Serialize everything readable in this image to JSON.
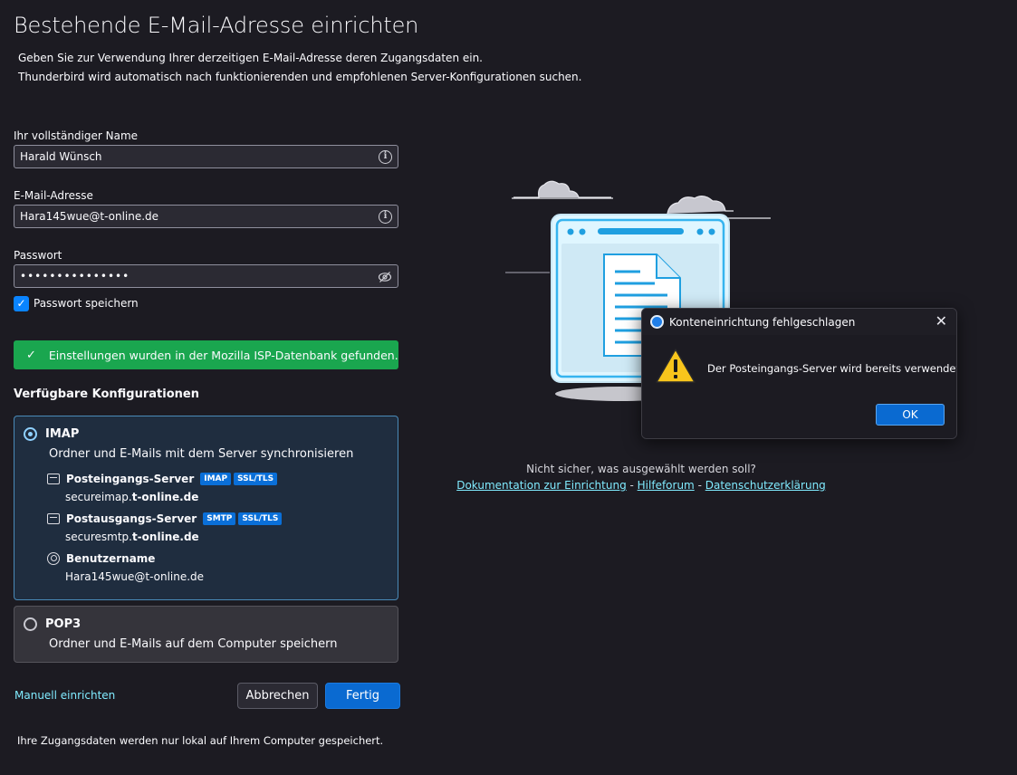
{
  "page": {
    "title": "Bestehende E-Mail-Adresse einrichten",
    "intro_line1": "Geben Sie zur Verwendung Ihrer derzeitigen E-Mail-Adresse deren Zugangsdaten ein.",
    "intro_line2": "Thunderbird wird automatisch nach funktionierenden und empfohlenen Server-Konfigurationen suchen."
  },
  "form": {
    "name_label": "Ihr vollständiger Name",
    "name_value": "Harald Wünsch",
    "email_label": "E-Mail-Adresse",
    "email_value": "Hara145wue@t-online.de",
    "password_label": "Passwort",
    "password_value": "•••••••••••••••",
    "save_password_label": "Passwort speichern",
    "save_password_checked": true
  },
  "status": {
    "success_message": "Einstellungen wurden in der Mozilla ISP-Datenbank gefunden.",
    "success_color": "#1aa64f"
  },
  "configs": {
    "heading": "Verfügbare Konfigurationen",
    "imap": {
      "title": "IMAP",
      "description": "Ordner und E-Mails mit dem Server synchronisieren",
      "selected": true,
      "incoming_label": "Posteingangs-Server",
      "incoming_badges": [
        "IMAP",
        "SSL/TLS"
      ],
      "incoming_host_prefix": "secureimap.",
      "incoming_host_domain": "t-online.de",
      "outgoing_label": "Postausgangs-Server",
      "outgoing_badges": [
        "SMTP",
        "SSL/TLS"
      ],
      "outgoing_host_prefix": "securesmtp.",
      "outgoing_host_domain": "t-online.de",
      "username_label": "Benutzername",
      "username_value": "Hara145wue@t-online.de"
    },
    "pop3": {
      "title": "POP3",
      "description": "Ordner und E-Mails auf dem Computer speichern",
      "selected": false
    }
  },
  "actions": {
    "manual_link": "Manuell einrichten",
    "cancel_label": "Abbrechen",
    "done_label": "Fertig"
  },
  "footer": {
    "note": "Ihre Zugangsdaten werden nur lokal auf Ihrem Computer gespeichert."
  },
  "help": {
    "unsure_text": "Nicht sicher, was ausgewählt werden soll?",
    "link_docs": "Dokumentation zur Einrichtung",
    "link_forum": "Hilfeforum",
    "link_privacy": "Datenschutzerklärung",
    "separator": " - "
  },
  "dialog": {
    "title": "Konteneinrichtung fehlgeschlagen",
    "message": "Der Posteingangs-Server wird bereits verwendet.",
    "ok_label": "OK",
    "close_glyph": "✕"
  },
  "icons": {
    "info": "info-icon",
    "eye_off": "eye-off-icon",
    "check": "checkmark-icon",
    "warning": "warning-icon",
    "server": "server-icon",
    "user": "user-icon"
  }
}
